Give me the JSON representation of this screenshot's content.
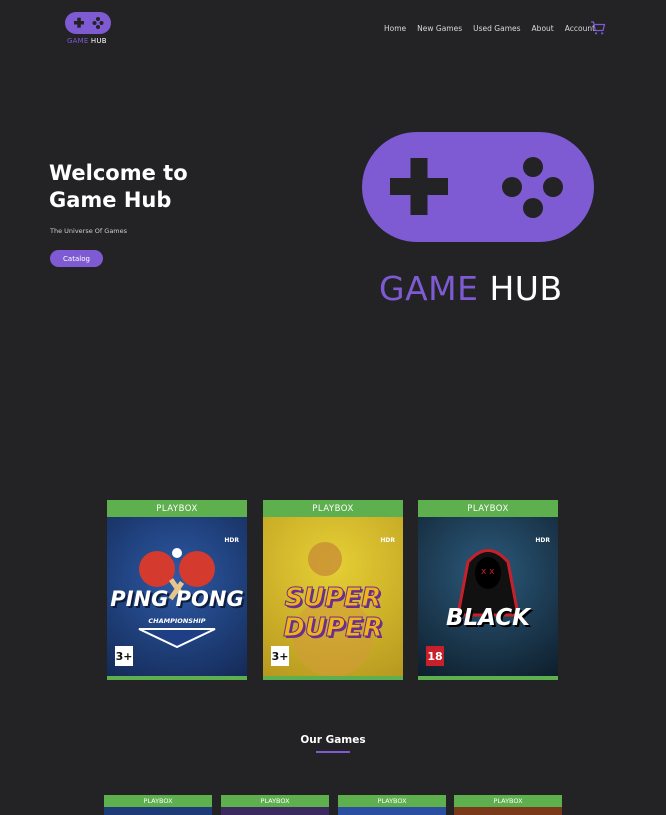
{
  "brand": {
    "small_logo_word1": "GAME",
    "small_logo_word2": "HUB"
  },
  "nav": [
    "Home",
    "New Games",
    "Used Games",
    "About",
    "Account"
  ],
  "hero": {
    "title": "Welcome to Game Hub",
    "subtitle": "The Universe Of Games",
    "cta_label": "Catalog",
    "logo_word1": "GAME",
    "logo_word2": "HUB"
  },
  "featured": [
    {
      "brand": "PLAYBOX",
      "hdr": "HDR",
      "title_line1": "PING PONG",
      "title_line2": "CHAMPIONSHIP",
      "rating": "3+"
    },
    {
      "brand": "PLAYBOX",
      "hdr": "HDR",
      "title_line1": "SUPER",
      "title_line2": "DUPER",
      "rating": "3+"
    },
    {
      "brand": "PLAYBOX",
      "hdr": "HDR",
      "title_line1": "BLACK",
      "title_line2": "",
      "rating": "18"
    }
  ],
  "section": {
    "title": "Our Games"
  },
  "games": [
    {
      "brand": "PLAYBOX"
    },
    {
      "brand": "PLAYBOX"
    },
    {
      "brand": "PLAYBOX"
    },
    {
      "brand": "PLAYBOX"
    }
  ],
  "colors": {
    "accent": "#7e5bd3",
    "background": "#232224",
    "cover_band": "#5db04d"
  }
}
